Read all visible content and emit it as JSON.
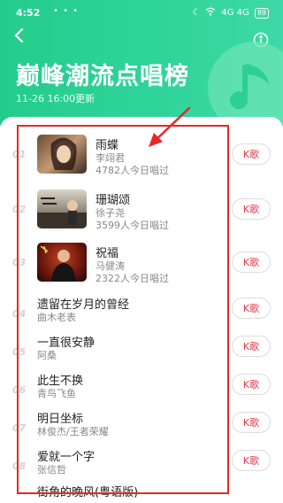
{
  "status_bar": {
    "time": "4:52",
    "dots": "• • •",
    "signal": "4G 4G",
    "battery": "89"
  },
  "header": {
    "title": "巅峰潮流点唱榜",
    "updated": "11-26 16:00更新",
    "colors": {
      "gradient_start": "#24cc8c",
      "gradient_end": "#3ed9a6"
    }
  },
  "list": {
    "k_label": "K歌",
    "items": [
      {
        "rank": "01",
        "song": "雨蝶",
        "artist": "李翊君",
        "plays": "4782人今日唱过"
      },
      {
        "rank": "02",
        "song": "珊瑚颂",
        "artist": "徐子尧",
        "plays": "3599人今日唱过"
      },
      {
        "rank": "03",
        "song": "祝福",
        "artist": "马健涛",
        "plays": "2322人今日唱过"
      },
      {
        "rank": "04",
        "song": "遗留在岁月的曾经",
        "artist": "曲木老表"
      },
      {
        "rank": "05",
        "song": "一直很安静",
        "artist": "阿桑"
      },
      {
        "rank": "06",
        "song": "此生不换",
        "artist": "青鸟飞鱼"
      },
      {
        "rank": "07",
        "song": "明日坐标",
        "artist": "林俊杰/王者荣耀"
      },
      {
        "rank": "08",
        "song": "爱就一个字",
        "artist": "张信哲"
      }
    ],
    "partial_next": "街角的晚风(粤语版)"
  },
  "annotation_color": "#e62828"
}
